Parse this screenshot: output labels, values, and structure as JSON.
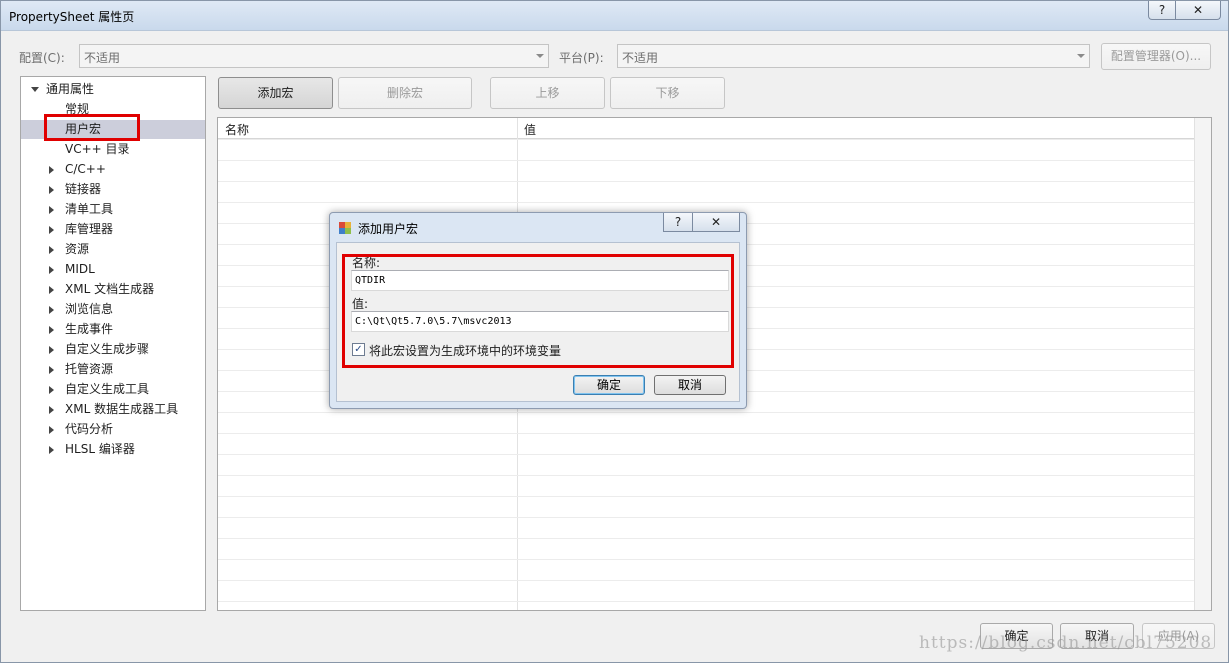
{
  "window": {
    "title": "PropertySheet 属性页",
    "help_glyph": "?",
    "close_glyph": "✕"
  },
  "toolbar": {
    "config_label": "配置(C):",
    "config_value": "不适用",
    "platform_label": "平台(P):",
    "platform_value": "不适用",
    "config_manager_label": "配置管理器(O)..."
  },
  "tree": {
    "root_label": "通用属性",
    "items": [
      {
        "label": "常规",
        "expandable": false
      },
      {
        "label": "用户宏",
        "expandable": false,
        "selected": true
      },
      {
        "label": "VC++ 目录",
        "expandable": false
      },
      {
        "label": "C/C++",
        "expandable": true
      },
      {
        "label": "链接器",
        "expandable": true
      },
      {
        "label": "清单工具",
        "expandable": true
      },
      {
        "label": "库管理器",
        "expandable": true
      },
      {
        "label": "资源",
        "expandable": true
      },
      {
        "label": "MIDL",
        "expandable": true
      },
      {
        "label": "XML 文档生成器",
        "expandable": true
      },
      {
        "label": "浏览信息",
        "expandable": true
      },
      {
        "label": "生成事件",
        "expandable": true
      },
      {
        "label": "自定义生成步骤",
        "expandable": true
      },
      {
        "label": "托管资源",
        "expandable": true
      },
      {
        "label": "自定义生成工具",
        "expandable": true
      },
      {
        "label": "XML 数据生成器工具",
        "expandable": true
      },
      {
        "label": "代码分析",
        "expandable": true
      },
      {
        "label": "HLSL 编译器",
        "expandable": true
      }
    ]
  },
  "macro_buttons": {
    "add": "添加宏",
    "delete": "删除宏",
    "move_up": "上移",
    "move_down": "下移"
  },
  "grid": {
    "columns": [
      "名称",
      "值"
    ]
  },
  "dialog": {
    "title": "添加用户宏",
    "name_label": "名称:",
    "name_value": "QTDIR",
    "value_label": "值:",
    "value_value": "C:\\Qt\\Qt5.7.0\\5.7\\msvc2013",
    "env_checkbox_label": "将此宏设置为生成环境中的环境变量",
    "env_checkbox_checked": true,
    "ok_label": "确定",
    "cancel_label": "取消"
  },
  "footer": {
    "ok_label": "确定",
    "cancel_label": "取消",
    "apply_label": "应用(A)",
    "watermark": "https://blog.csdn.net/cbl75208"
  },
  "colors": {
    "highlight_red": "#e00000",
    "selection": "#cccedb"
  }
}
